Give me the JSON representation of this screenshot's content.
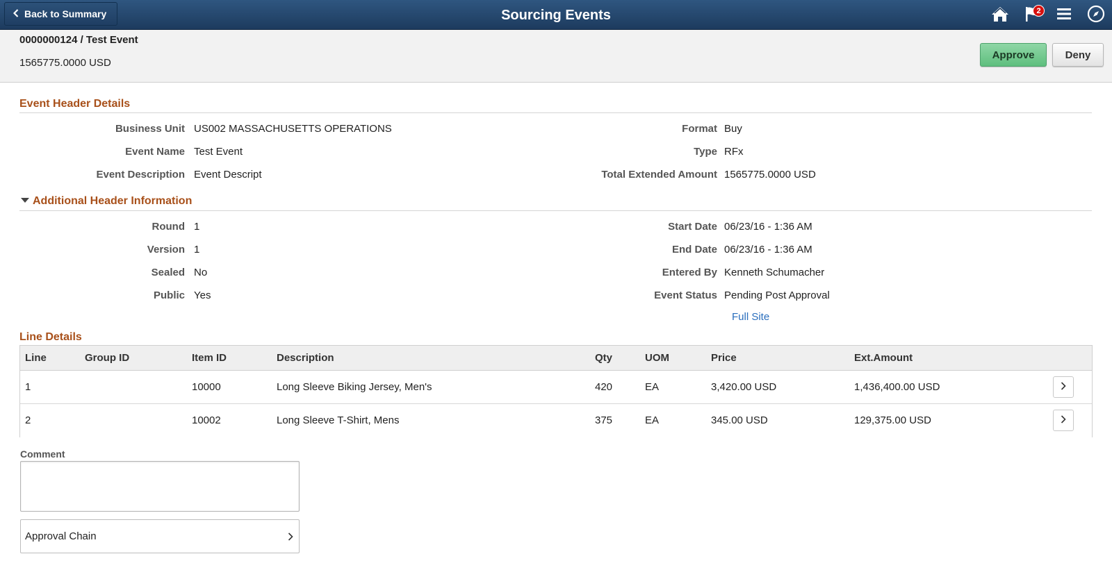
{
  "banner": {
    "back_label": "Back to Summary",
    "title": "Sourcing Events",
    "notification_count": "2"
  },
  "subheader": {
    "event_title": "0000000124 / Test Event",
    "amount": "1565775.0000 USD",
    "approve_label": "Approve",
    "deny_label": "Deny"
  },
  "event_header": {
    "title": "Event Header Details",
    "left": [
      {
        "label": "Business Unit",
        "value": "US002 MASSACHUSETTS OPERATIONS"
      },
      {
        "label": "Event Name",
        "value": "Test Event"
      },
      {
        "label": "Event Description",
        "value": "Event Descript"
      }
    ],
    "right": [
      {
        "label": "Format",
        "value": "Buy"
      },
      {
        "label": "Type",
        "value": "RFx"
      },
      {
        "label": "Total Extended Amount",
        "value": "1565775.0000 USD"
      }
    ]
  },
  "additional": {
    "title": "Additional Header Information",
    "left": [
      {
        "label": "Round",
        "value": "1"
      },
      {
        "label": "Version",
        "value": "1"
      },
      {
        "label": "Sealed",
        "value": "No"
      },
      {
        "label": "Public",
        "value": "Yes"
      }
    ],
    "right": [
      {
        "label": "Start Date",
        "value": "06/23/16 - 1:36 AM"
      },
      {
        "label": "End Date",
        "value": "06/23/16 - 1:36 AM"
      },
      {
        "label": "Entered By",
        "value": "Kenneth Schumacher"
      },
      {
        "label": "Event Status",
        "value": "Pending Post Approval"
      }
    ],
    "full_site_link": "Full Site"
  },
  "line_details": {
    "title": "Line Details",
    "columns": [
      "Line",
      "Group ID",
      "Item ID",
      "Description",
      "Qty",
      "UOM",
      "Price",
      "Ext.Amount"
    ],
    "rows": [
      [
        "1",
        "",
        "10000",
        "Long Sleeve Biking Jersey, Men's",
        "420",
        "EA",
        "3,420.00 USD",
        "1,436,400.00 USD"
      ],
      [
        "2",
        "",
        "10002",
        "Long Sleeve T-Shirt, Mens",
        "375",
        "EA",
        "345.00 USD",
        "129,375.00 USD"
      ]
    ]
  },
  "comment": {
    "label": "Comment",
    "value": ""
  },
  "approval_chain": {
    "label": "Approval Chain"
  },
  "icons": {
    "back": "chevron-left-icon",
    "home": "home-icon",
    "notifications": "flag-icon",
    "menu": "hamburger-menu-icon",
    "navbar": "compass-icon",
    "row_detail": "chevron-right-icon"
  },
  "colors": {
    "banner": "#1d3b5e",
    "section_title": "#a8501a",
    "approve": "#5fbf7e",
    "link": "#2a6ebd",
    "badge": "#d7100e"
  }
}
